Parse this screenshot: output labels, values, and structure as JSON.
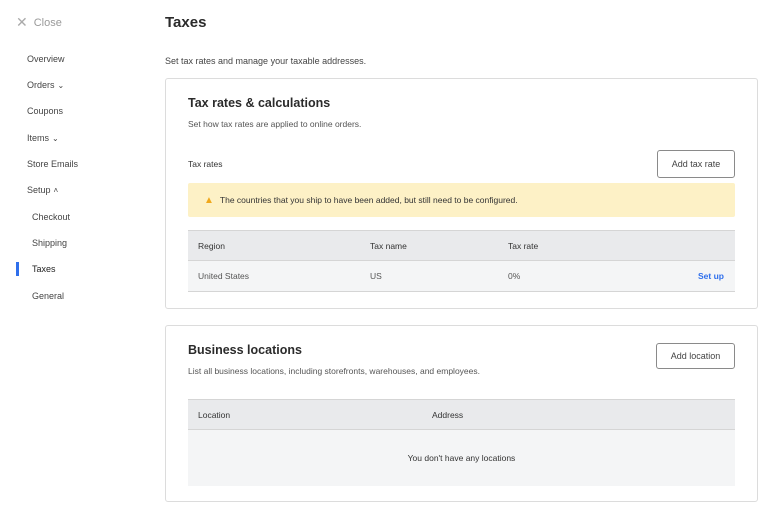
{
  "sidebar": {
    "close_label": "Close",
    "items": [
      {
        "label": "Overview"
      },
      {
        "label": "Orders",
        "chevron": "down"
      },
      {
        "label": "Coupons"
      },
      {
        "label": "Items",
        "chevron": "down"
      },
      {
        "label": "Store Emails"
      },
      {
        "label": "Setup",
        "chevron": "up"
      }
    ],
    "sub_items": [
      {
        "label": "Checkout"
      },
      {
        "label": "Shipping"
      },
      {
        "label": "Taxes",
        "active": true
      },
      {
        "label": "General"
      }
    ]
  },
  "page": {
    "title": "Taxes",
    "subtitle": "Set tax rates and manage your taxable addresses."
  },
  "tax_card": {
    "title": "Tax rates & calculations",
    "description": "Set how tax rates are applied to online orders.",
    "section_label": "Tax rates",
    "add_button": "Add tax rate",
    "alert": "The countries that you ship to have been added, but still need to be configured.",
    "columns": [
      "Region",
      "Tax name",
      "Tax rate"
    ],
    "rows": [
      {
        "region": "United States",
        "tax_name": "US",
        "tax_rate": "0%",
        "action": "Set up"
      }
    ]
  },
  "locations_card": {
    "title": "Business locations",
    "description": "List all business locations, including storefronts, warehouses, and employees.",
    "add_button": "Add location",
    "columns": [
      "Location",
      "Address"
    ],
    "empty_text": "You don't have any locations"
  },
  "colors": {
    "accent": "#2f6fec",
    "alert_bg": "#fdf1c6",
    "warning_icon": "#f0a81c"
  }
}
